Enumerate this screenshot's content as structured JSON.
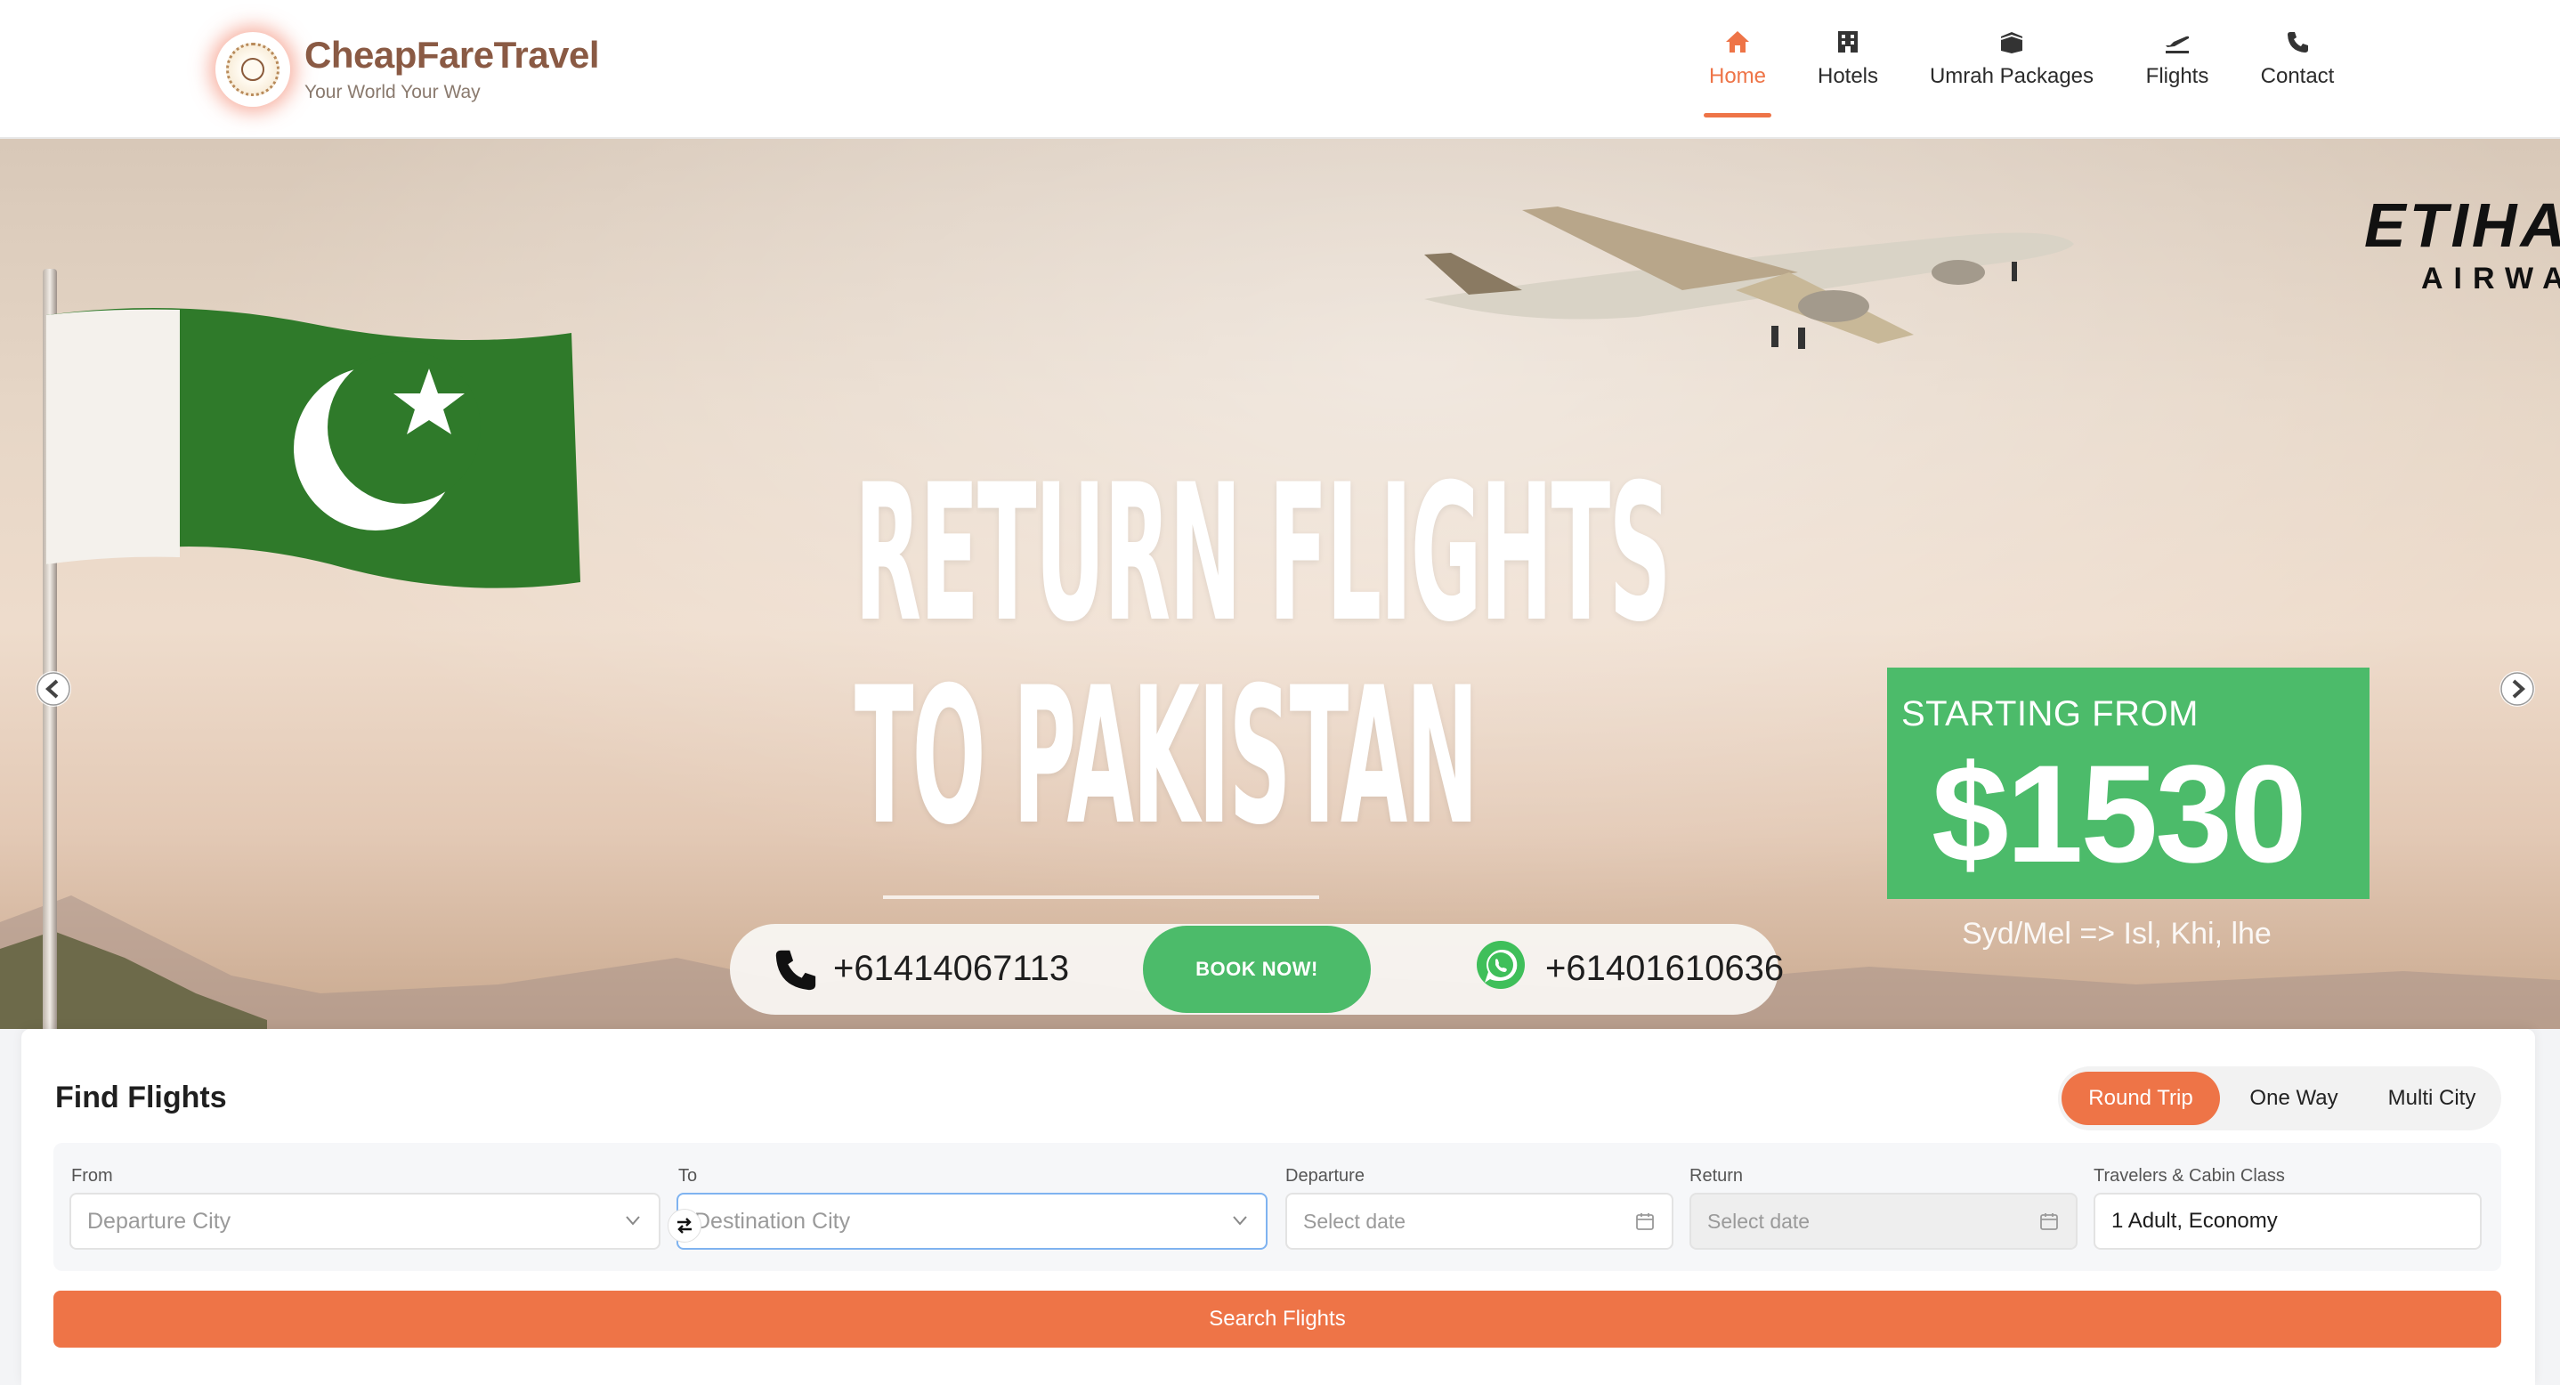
{
  "brand": {
    "name": "CheapFareTravel",
    "tagline": "Your World Your Way"
  },
  "nav": [
    {
      "label": "Home",
      "icon": "home-icon",
      "active": true
    },
    {
      "label": "Hotels",
      "icon": "hotel-icon",
      "active": false
    },
    {
      "label": "Umrah Packages",
      "icon": "kaaba-icon",
      "active": false
    },
    {
      "label": "Flights",
      "icon": "plane-takeoff-icon",
      "active": false
    },
    {
      "label": "Contact",
      "icon": "phone-icon",
      "active": false
    }
  ],
  "hero": {
    "headline_line1": "RETURN FLIGHTS",
    "headline_line2": "TO PAKISTAN",
    "airline_line1": "ETIHA",
    "airline_line2": "AIRWA",
    "phone": "+61414067113",
    "book_label": "BOOK NOW!",
    "whatsapp": "+61401610636",
    "price_prefix": "STARTING FROM",
    "price": "$1530",
    "route": "Syd/Mel => Isl, Khi, lhe"
  },
  "finder": {
    "title": "Find Flights",
    "trip_types": [
      "Round Trip",
      "One Way",
      "Multi City"
    ],
    "selected_trip": "Round Trip",
    "from_label": "From",
    "from_placeholder": "Departure City",
    "to_label": "To",
    "to_placeholder": "Destination City",
    "departure_label": "Departure",
    "departure_placeholder": "Select date",
    "return_label": "Return",
    "return_placeholder": "Select date",
    "travelers_label": "Travelers & Cabin Class",
    "travelers_value": "1 Adult, Economy",
    "search_label": "Search Flights"
  },
  "colors": {
    "accent": "#ee7447",
    "promo_green": "#4cbb6a",
    "brand_brown": "#8a5a44"
  }
}
